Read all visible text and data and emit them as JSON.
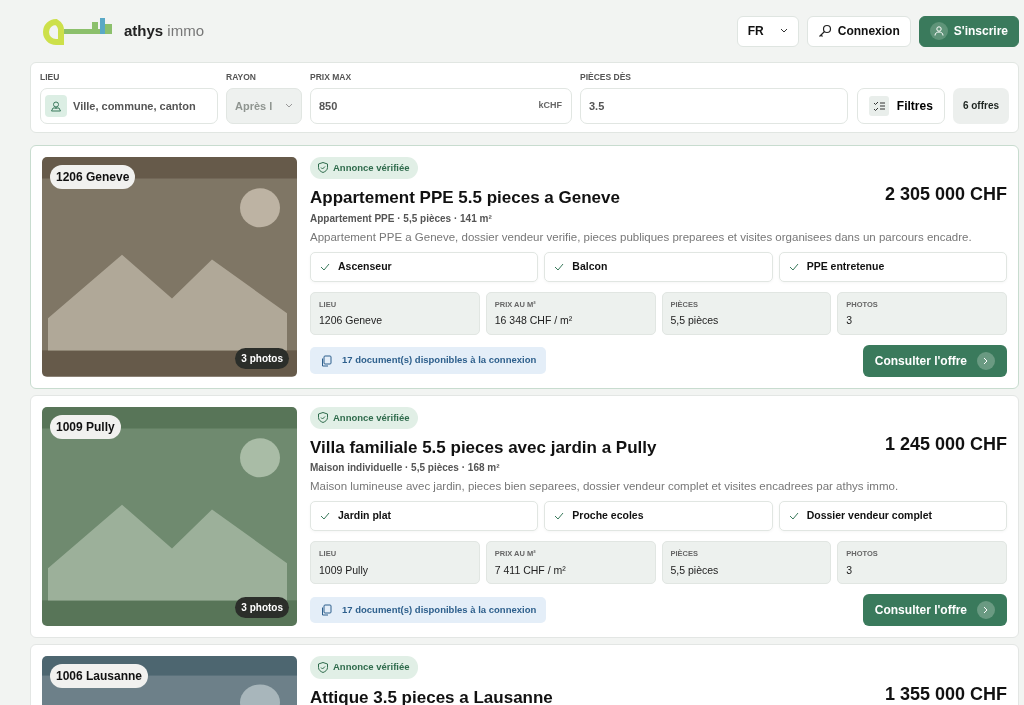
{
  "header": {
    "logo": {
      "brand": "athys",
      "suffix": "immo"
    },
    "language": "FR",
    "login": "Connexion",
    "signup": "S'inscrire"
  },
  "search": {
    "fields": [
      {
        "kind": "location",
        "label": "LIEU",
        "placeholder": "Ville, commune, canton"
      },
      {
        "kind": "select",
        "label": "RAYON",
        "value": "Après l",
        "disabled": true
      },
      {
        "kind": "price",
        "label": "PRIX MAX",
        "value": "850",
        "unit": "kCHF"
      },
      {
        "kind": "text",
        "label": "PIÈCES DÈS",
        "value": "3.5"
      }
    ],
    "filters": "Filtres",
    "count": "6 offres"
  },
  "listings": [
    {
      "highlighted": true,
      "location": "1206 Geneve",
      "photos": "3 photos",
      "badge": "Annonce vérifiée",
      "title": "Appartement PPE 5.5 pieces a Geneve",
      "price": "2 305 000 CHF",
      "subtitle": "Appartement PPE · 5,5 pièces · 141 m²",
      "description": "Appartement PPE a Geneve, dossier vendeur verifie, pieces publiques preparees et visites organisees dans un parcours encadre.",
      "features": [
        "Ascenseur",
        "Balcon",
        "PPE entretenue"
      ],
      "facts": [
        {
          "label": "LIEU",
          "value": "1206 Geneve"
        },
        {
          "label": "PRIX AU M²",
          "value": "16 348 CHF / m²"
        },
        {
          "label": "PIÈCES",
          "value": "5,5 pièces"
        },
        {
          "label": "PHOTOS",
          "value": "3"
        }
      ],
      "documents": "17 document(s) disponibles à la connexion",
      "cta": "Consulter l'offre"
    },
    {
      "highlighted": false,
      "location": "1009 Pully",
      "photos": "3 photos",
      "badge": "Annonce vérifiée",
      "title": "Villa familiale 5.5 pieces avec jardin a Pully",
      "price": "1 245 000 CHF",
      "subtitle": "Maison individuelle · 5,5 pièces · 168 m²",
      "description": "Maison lumineuse avec jardin, pieces bien separees, dossier vendeur complet et visites encadrees par athys immo.",
      "features": [
        "Jardin plat",
        "Proche ecoles",
        "Dossier vendeur complet"
      ],
      "facts": [
        {
          "label": "LIEU",
          "value": "1009 Pully"
        },
        {
          "label": "PRIX AU M²",
          "value": "7 411 CHF / m²"
        },
        {
          "label": "PIÈCES",
          "value": "5,5 pièces"
        },
        {
          "label": "PHOTOS",
          "value": "3"
        }
      ],
      "documents": "17 document(s) disponibles à la connexion",
      "cta": "Consulter l'offre"
    },
    {
      "highlighted": false,
      "location": "1006 Lausanne",
      "badge": "Annonce vérifiée",
      "title": "Attique 3.5 pieces a Lausanne",
      "price": "1 355 000 CHF"
    }
  ]
}
